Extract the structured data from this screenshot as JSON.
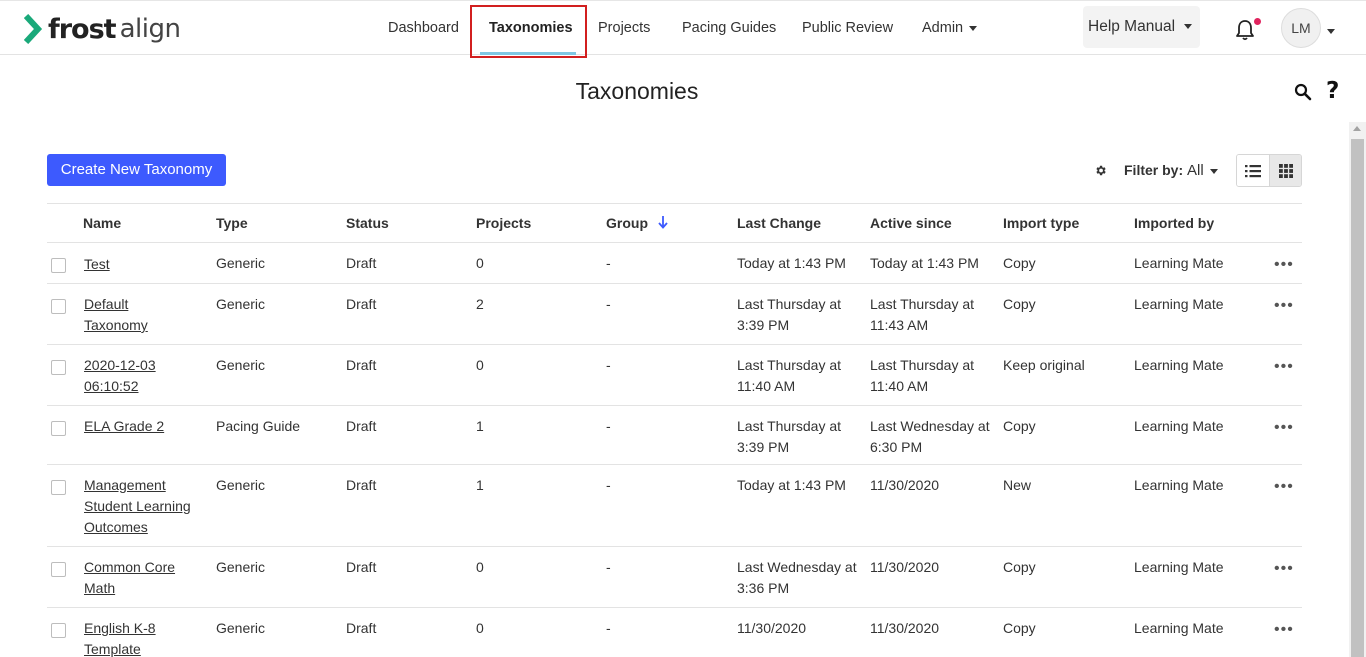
{
  "brand": {
    "name_bold": "frost",
    "name_light": "align",
    "color": "#1aa97a"
  },
  "nav": {
    "items": [
      {
        "label": "Dashboard"
      },
      {
        "label": "Taxonomies",
        "active": true
      },
      {
        "label": "Projects"
      },
      {
        "label": "Pacing Guides"
      },
      {
        "label": "Public Review"
      },
      {
        "label": "Admin",
        "dropdown": true
      }
    ]
  },
  "header": {
    "help_label": "Help Manual",
    "user_initials": "LM",
    "notification_badge_color": "#e0245e"
  },
  "page": {
    "title": "Taxonomies",
    "help_glyph": "?"
  },
  "toolbar": {
    "create_label": "Create New Taxonomy",
    "create_color": "#3d5afe",
    "filter_label": "Filter by:",
    "filter_value": "All"
  },
  "table": {
    "columns": [
      "Name",
      "Type",
      "Status",
      "Projects",
      "Group",
      "Last Change",
      "Active since",
      "Import type",
      "Imported by"
    ],
    "sorted_column": "Group",
    "rows": [
      {
        "name": "Test",
        "type": "Generic",
        "status": "Draft",
        "projects": "0",
        "group": "-",
        "last_change": "Today at 1:43 PM",
        "active_since": "Today at 1:43 PM",
        "import_type": "Copy",
        "imported_by": "Learning Mate"
      },
      {
        "name": "Default Taxonomy",
        "type": "Generic",
        "status": "Draft",
        "projects": "2",
        "group": "-",
        "last_change": "Last Thursday at 3:39 PM",
        "active_since": "Last Thursday at 11:43 AM",
        "import_type": "Copy",
        "imported_by": "Learning Mate"
      },
      {
        "name": "2020-12-03 06:10:52",
        "type": "Generic",
        "status": "Draft",
        "projects": "0",
        "group": "-",
        "last_change": "Last Thursday at 11:40 AM",
        "active_since": "Last Thursday at 11:40 AM",
        "import_type": "Keep original",
        "imported_by": "Learning Mate"
      },
      {
        "name": "ELA Grade 2",
        "type": "Pacing Guide",
        "status": "Draft",
        "projects": "1",
        "group": "-",
        "last_change": "Last Thursday at 3:39 PM",
        "active_since": "Last Wednesday at 6:30 PM",
        "import_type": "Copy",
        "imported_by": "Learning Mate"
      },
      {
        "name": "Management Student Learning Outcomes",
        "type": "Generic",
        "status": "Draft",
        "projects": "1",
        "group": "-",
        "last_change": "Today at 1:43 PM",
        "active_since": "11/30/2020",
        "import_type": "New",
        "imported_by": "Learning Mate"
      },
      {
        "name": "Common Core Math",
        "type": "Generic",
        "status": "Draft",
        "projects": "0",
        "group": "-",
        "last_change": "Last Wednesday at 3:36 PM",
        "active_since": "11/30/2020",
        "import_type": "Copy",
        "imported_by": "Learning Mate"
      },
      {
        "name": "English K-8 Template",
        "type": "Generic",
        "status": "Draft",
        "projects": "0",
        "group": "-",
        "last_change": "11/30/2020",
        "active_since": "11/30/2020",
        "import_type": "Copy",
        "imported_by": "Learning Mate"
      }
    ],
    "row_action_glyph": "•••"
  }
}
